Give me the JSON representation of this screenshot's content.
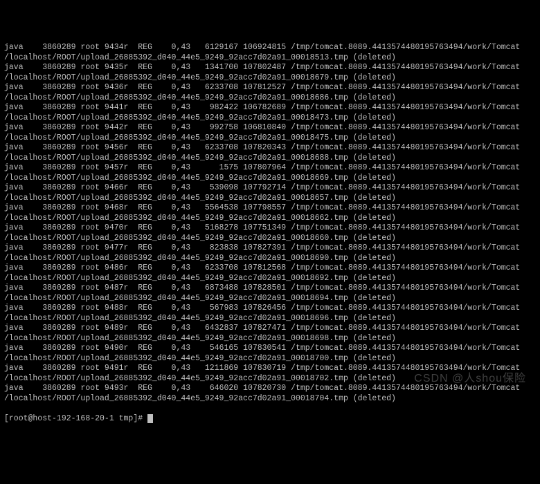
{
  "common": {
    "cmd": "java",
    "pid": "3860289",
    "user": "root",
    "type": "REG",
    "device": "0,43",
    "path_prefix": "/tmp/tomcat.8089.4413574480195763494/work/Tomcat",
    "upload_prefix": "/localhost/ROOT/upload_26885392_d040_44e5_9249_92acc7d02a91_",
    "deleted": "(deleted)"
  },
  "rows": [
    {
      "fd": "9434r",
      "size": "6129167",
      "node": "106924815",
      "suffix": "00018513.tmp"
    },
    {
      "fd": "9435r",
      "size": "1341700",
      "node": "107802487",
      "suffix": "00018679.tmp"
    },
    {
      "fd": "9436r",
      "size": "6233708",
      "node": "107812527",
      "suffix": "00018686.tmp"
    },
    {
      "fd": "9441r",
      "size": "982422",
      "node": "106782689",
      "suffix": "00018473.tmp"
    },
    {
      "fd": "9442r",
      "size": "992758",
      "node": "106810840",
      "suffix": "00018475.tmp"
    },
    {
      "fd": "9456r",
      "size": "6233708",
      "node": "107820343",
      "suffix": "00018688.tmp"
    },
    {
      "fd": "9457r",
      "size": "1575",
      "node": "107807964",
      "suffix": "00018669.tmp"
    },
    {
      "fd": "9466r",
      "size": "539098",
      "node": "107792714",
      "suffix": "00018657.tmp"
    },
    {
      "fd": "9468r",
      "size": "5564538",
      "node": "107798557",
      "suffix": "00018662.tmp"
    },
    {
      "fd": "9470r",
      "size": "5168278",
      "node": "107751349",
      "suffix": "00018660.tmp"
    },
    {
      "fd": "9477r",
      "size": "823838",
      "node": "107827391",
      "suffix": "00018690.tmp"
    },
    {
      "fd": "9486r",
      "size": "6233708",
      "node": "107812568",
      "suffix": "00018692.tmp"
    },
    {
      "fd": "9487r",
      "size": "6873488",
      "node": "107828501",
      "suffix": "00018694.tmp"
    },
    {
      "fd": "9488r",
      "size": "567983",
      "node": "107826456",
      "suffix": "00018696.tmp"
    },
    {
      "fd": "9489r",
      "size": "6432837",
      "node": "107827471",
      "suffix": "00018698.tmp"
    },
    {
      "fd": "9490r",
      "size": "546165",
      "node": "107830541",
      "suffix": "00018700.tmp"
    },
    {
      "fd": "9491r",
      "size": "1211869",
      "node": "107830719",
      "suffix": "00018702.tmp"
    },
    {
      "fd": "9493r",
      "size": "646020",
      "node": "107820730",
      "suffix": "00018704.tmp"
    }
  ],
  "prompt": "[root@host-192-168-20-1 tmp]#",
  "watermark": "CSDN @人shou保险"
}
